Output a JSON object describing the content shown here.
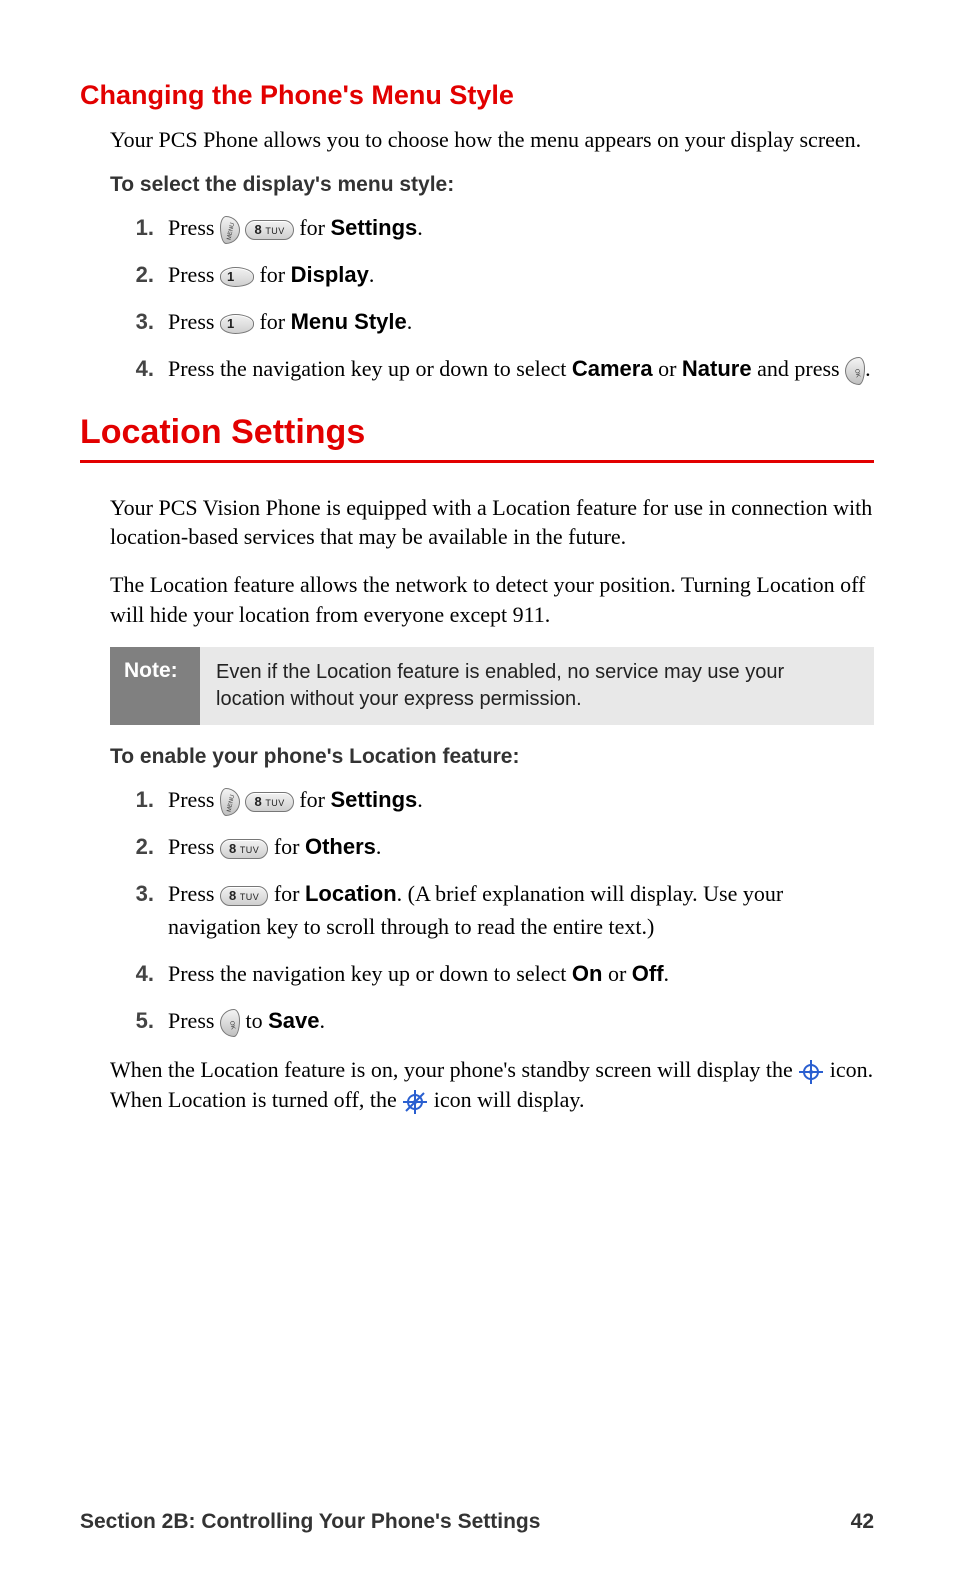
{
  "heading1": "Changing the Phone's Menu Style",
  "p1": "Your PCS Phone allows you to choose how the menu appears on your display screen.",
  "instr1": "To select the display's menu style:",
  "s1": {
    "i1_a": "Press ",
    "i1_b": " for ",
    "i1_c": "Settings",
    "i1_d": ".",
    "i2_a": "Press ",
    "i2_b": " for ",
    "i2_c": "Display",
    "i2_d": ".",
    "i3_a": "Press ",
    "i3_b": " for ",
    "i3_c": "Menu Style",
    "i3_d": ".",
    "i4_a": "Press the navigation key up or down to select ",
    "i4_b": "Camera",
    "i4_c": " or ",
    "i4_d": "Nature",
    "i4_e": " and press ",
    "i4_f": "."
  },
  "heading2": "Location Settings",
  "p2": "Your PCS Vision Phone is equipped with a Location feature for use in connection with location-based services that may be available in the future.",
  "p3": "The Location feature allows the network to detect your position. Turning Location off will hide your location from everyone except 911.",
  "note_label": "Note:",
  "note_body": "Even if the Location feature is enabled, no service may use your location without your express permission.",
  "instr2": "To enable your phone's Location feature:",
  "s2": {
    "i1_a": "Press ",
    "i1_b": " for ",
    "i1_c": "Settings",
    "i1_d": ".",
    "i2_a": "Press ",
    "i2_b": " for ",
    "i2_c": "Others",
    "i2_d": ".",
    "i3_a": "Press ",
    "i3_b": " for ",
    "i3_c": "Location",
    "i3_d": ". (A brief explanation will display. Use your navigation key to scroll through to read the entire text.)",
    "i4_a": "Press the navigation key up or down to select ",
    "i4_b": "On",
    "i4_c": " or ",
    "i4_d": "Off",
    "i4_e": ".",
    "i5_a": "Press ",
    "i5_b": " to ",
    "i5_c": "Save",
    "i5_d": "."
  },
  "p4_a": "When the Location feature is on, your phone's standby screen will display the ",
  "p4_b": " icon. When Location is turned off, the ",
  "p4_c": " icon will display.",
  "footer_left": "Section 2B: Controlling Your Phone's Settings",
  "footer_right": "42",
  "key8": "8",
  "key8sub": "TUV",
  "key1": "1"
}
